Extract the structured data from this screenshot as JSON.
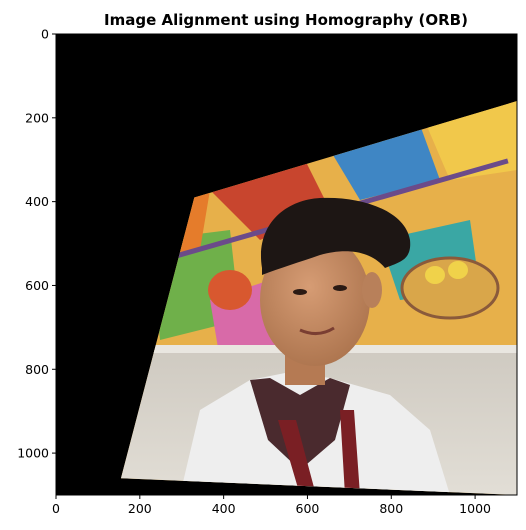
{
  "chart_data": {
    "type": "image",
    "title": "Image Alignment using Homography (ORB)",
    "xlabel": "",
    "ylabel": "",
    "xlim": [
      0,
      1100
    ],
    "ylim": [
      1100,
      0
    ],
    "xticks": [
      0,
      200,
      400,
      600,
      800,
      1000
    ],
    "yticks": [
      0,
      200,
      400,
      600,
      800,
      1000
    ],
    "xtick_labels": [
      "0",
      "200",
      "400",
      "600",
      "800",
      "1000"
    ],
    "ytick_labels": [
      "0",
      "200",
      "400",
      "600",
      "800",
      "1000"
    ],
    "grid": false,
    "image_content": {
      "background_color": "#000000",
      "warped_region_corners": [
        [
          1100,
          160
        ],
        [
          330,
          390
        ],
        [
          155,
          1060
        ],
        [
          1100,
          1100
        ]
      ],
      "mural_colors": [
        "#e8a33a",
        "#c8452e",
        "#3f86c4",
        "#6fb04a",
        "#f1c84b",
        "#d86aa8",
        "#8a5a3b"
      ],
      "wall_color": "#d8d4cc",
      "skin_color": "#c48a62",
      "hair_color": "#1d1614",
      "shirt_color": "#eeeeee",
      "lanyard_color": "#7a1f24"
    }
  }
}
